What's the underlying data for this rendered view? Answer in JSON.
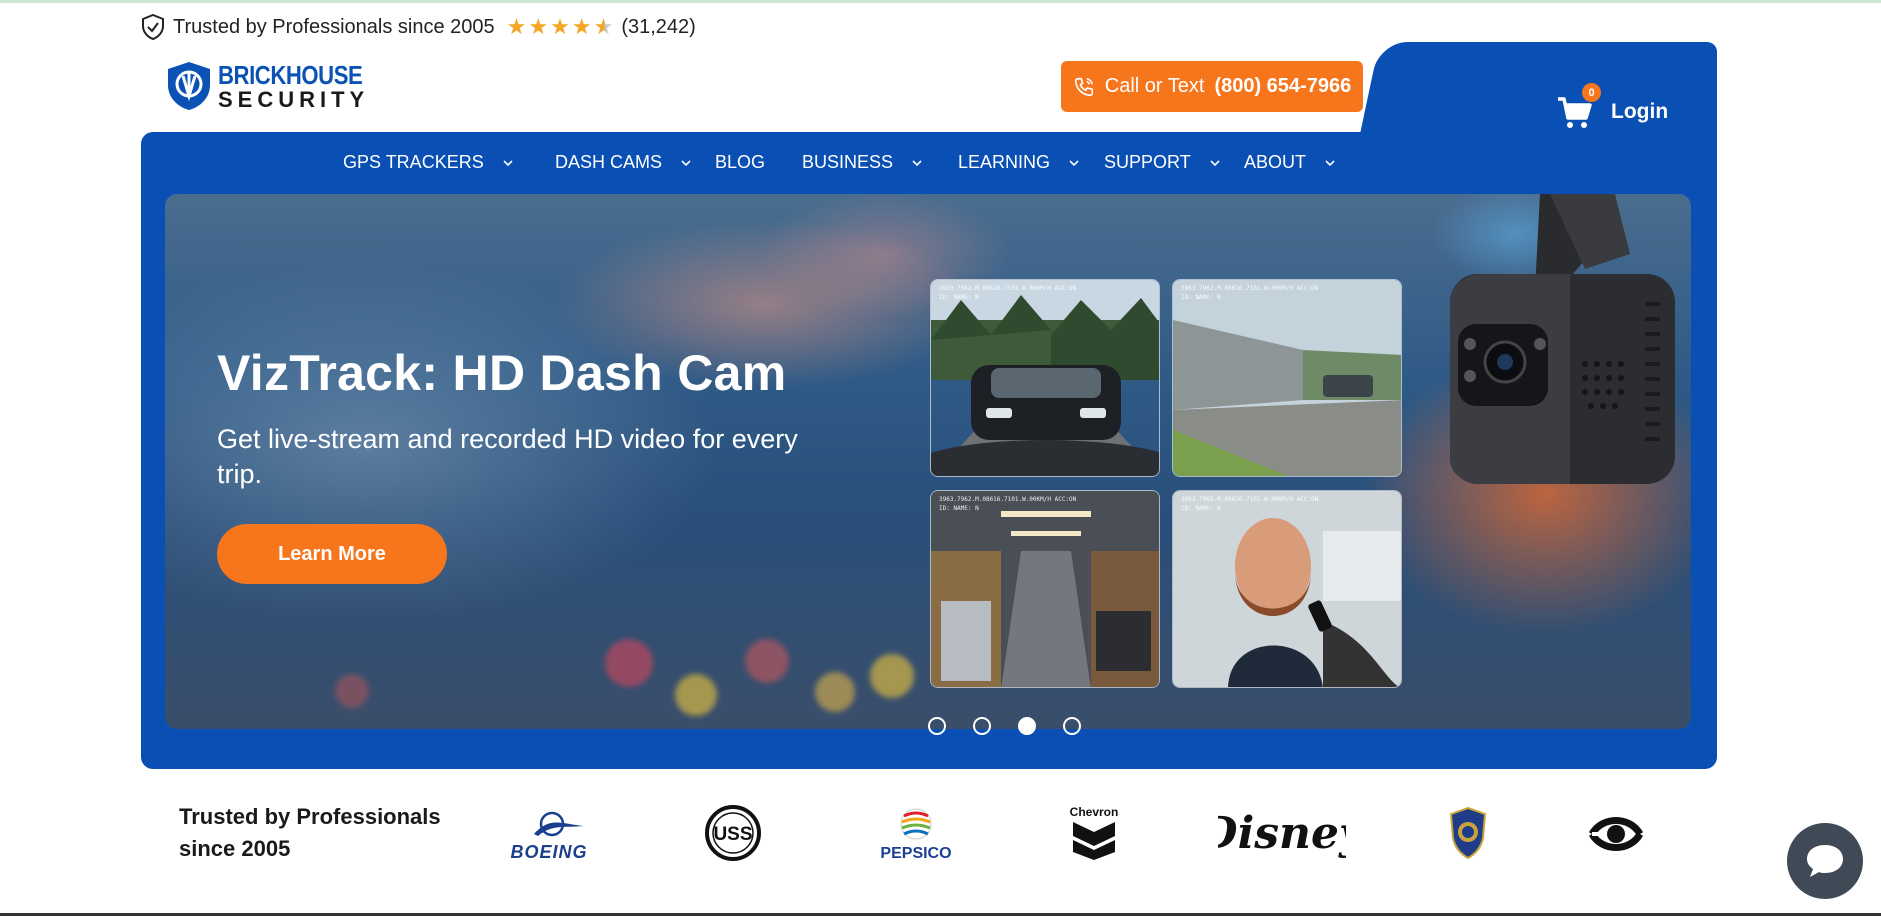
{
  "trust": {
    "text": "Trusted by Professionals since 2005",
    "rating": 4.5,
    "review_count": "(31,242)"
  },
  "logo": {
    "top": "BRICKHOUSE",
    "bottom": "SECURITY"
  },
  "call": {
    "prefix": "Call or Text",
    "number": "(800) 654-7966"
  },
  "header": {
    "cart_count": "0",
    "login_label": "Login"
  },
  "nav": {
    "items": [
      {
        "label": "GPS TRACKERS",
        "dropdown": true
      },
      {
        "label": "DASH CAMS",
        "dropdown": true
      },
      {
        "label": "BLOG",
        "dropdown": false
      },
      {
        "label": "BUSINESS",
        "dropdown": true
      },
      {
        "label": "LEARNING",
        "dropdown": true
      },
      {
        "label": "SUPPORT",
        "dropdown": true
      },
      {
        "label": "ABOUT",
        "dropdown": true
      }
    ]
  },
  "hero": {
    "title": "VizTrack: HD Dash Cam",
    "subtitle": "Get live-stream and recorded HD video for every trip.",
    "cta_label": "Learn More",
    "osd_line1": "3963.7962.M.08616.7101.W.00KM/H ACC:ON",
    "osd_line2": "ID: NAME: N",
    "slides_total": 4,
    "active_slide": 3
  },
  "trusted_strip": {
    "title": "Trusted by Professionals since 2005",
    "brands": [
      "BOEING",
      "USS",
      "PEPSICO",
      "Chevron",
      "Disney",
      "Police Department",
      "Eye"
    ]
  },
  "colors": {
    "brand_blue": "#0a4fb4",
    "accent_orange": "#f7751b",
    "star": "#f5a623"
  }
}
